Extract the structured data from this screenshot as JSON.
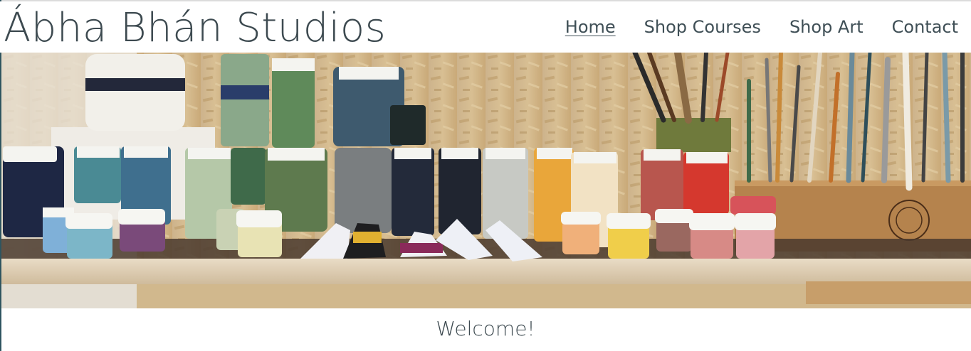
{
  "header": {
    "site_title": "Ábha Bhán Studios",
    "nav": [
      {
        "label": "Home",
        "active": true
      },
      {
        "label": "Shop Courses",
        "active": false
      },
      {
        "label": "Shop Art",
        "active": false
      },
      {
        "label": "Contact",
        "active": false
      }
    ]
  },
  "hero": {
    "image": "shelf-of-paint-jars-and-brushes"
  },
  "main": {
    "welcome_heading": "Welcome!"
  },
  "colors": {
    "text": "#3d4a50",
    "accent": "#2f5560"
  }
}
